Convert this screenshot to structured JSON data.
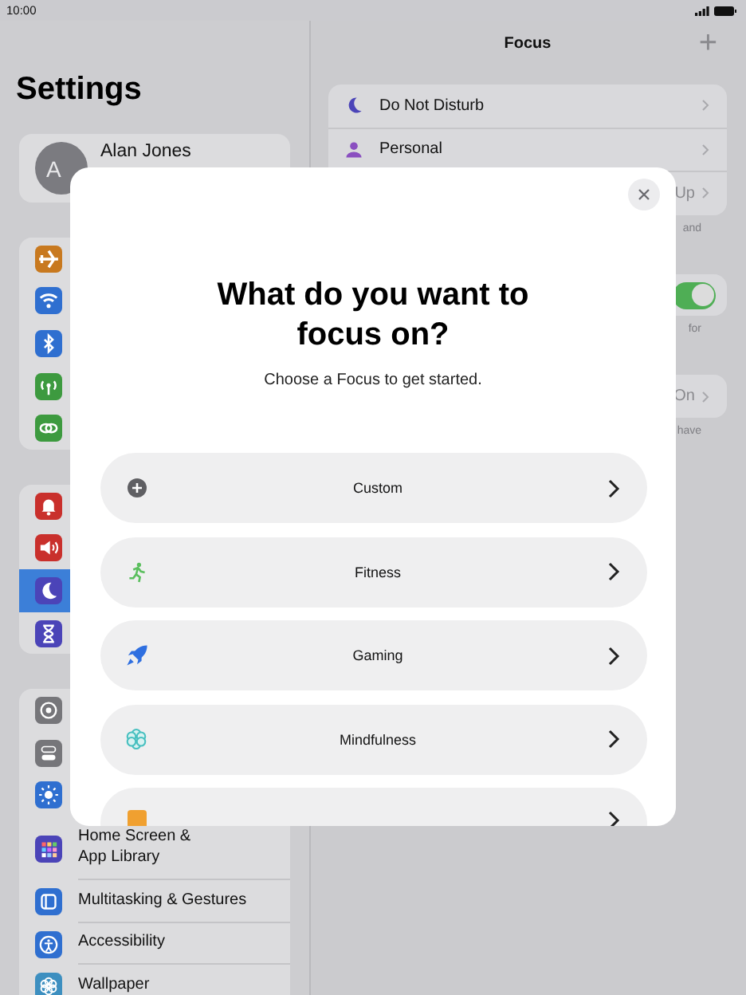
{
  "status_bar": {
    "time": "10:00"
  },
  "sidebar": {
    "title": "Settings",
    "profile": {
      "initials": "A",
      "name": "Alan Jones"
    },
    "groups": [
      [
        {
          "kind": "airplane",
          "color": "#c8791f",
          "selected": false
        },
        {
          "kind": "wifi",
          "color": "#2f6fd0",
          "selected": false
        },
        {
          "kind": "bluetooth",
          "color": "#2f6fd0",
          "selected": false
        },
        {
          "kind": "antenna",
          "color": "#3d9a3f",
          "selected": false
        },
        {
          "kind": "link",
          "color": "#3d9a3f",
          "selected": false
        }
      ],
      [
        {
          "kind": "bell",
          "color": "#c9302c",
          "selected": false
        },
        {
          "kind": "speaker",
          "color": "#c9302c",
          "selected": false
        },
        {
          "kind": "moon",
          "color": "#4b44b8",
          "selected": true
        },
        {
          "kind": "hourglass",
          "color": "#4b44b8",
          "selected": false
        }
      ],
      [
        {
          "kind": "gear",
          "color": "#76767a",
          "selected": false
        },
        {
          "kind": "switches",
          "color": "#76767a",
          "selected": false
        },
        {
          "kind": "sun",
          "color": "#2f6fd0",
          "selected": false
        },
        {
          "kind": "grid",
          "color": "#4b44b8",
          "label": "Home Screen &\nApp Library",
          "selected": false
        },
        {
          "kind": "list",
          "color": "#2f6fd0",
          "label": "Multitasking & Gestures",
          "selected": false
        },
        {
          "kind": "figure",
          "color": "#2f6fd0",
          "label": "Accessibility",
          "selected": false
        },
        {
          "kind": "flower",
          "color": "#3d8fc0",
          "label": "Wallpaper",
          "selected": false
        }
      ]
    ]
  },
  "detail": {
    "title": "Focus",
    "add": "+",
    "sections": [
      {
        "rows": [
          {
            "kind": "moon",
            "label": "Do Not Disturb"
          },
          {
            "kind": "person",
            "label": "Personal"
          },
          {
            "kind": "link",
            "value": "Up"
          }
        ],
        "footer": "and"
      },
      {
        "rows": [
          {
            "kind": "toggle",
            "on": true
          }
        ],
        "footer": "for"
      },
      {
        "rows": [
          {
            "kind": "link",
            "value": "On"
          }
        ],
        "footer": "have"
      }
    ]
  },
  "dialog": {
    "title": "What do you want to\nfocus on?",
    "subtitle": "Choose a Focus to get started.",
    "options": [
      {
        "kind": "plus",
        "label": "Custom"
      },
      {
        "kind": "runner",
        "label": "Fitness"
      },
      {
        "kind": "rocket",
        "label": "Gaming"
      },
      {
        "kind": "flower",
        "label": "Mindfulness"
      },
      {
        "kind": "book"
      }
    ]
  }
}
